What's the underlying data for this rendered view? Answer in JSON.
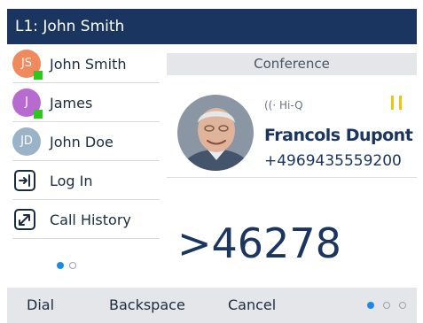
{
  "header": {
    "title": "L1: John Smith"
  },
  "sidebar": {
    "contacts": [
      {
        "initials": "JS",
        "name": "John Smith",
        "avatar_color": "#f08a5d",
        "presence": "available"
      },
      {
        "initials": "J",
        "name": "James",
        "avatar_color": "#b76bd1",
        "presence": "available"
      },
      {
        "initials": "JD",
        "name": "John Doe",
        "avatar_color": "#9bb3c7",
        "presence": "none"
      }
    ],
    "functions": [
      {
        "label": "Log In",
        "icon": "login-icon"
      },
      {
        "label": "Call History",
        "icon": "call-history-icon"
      }
    ],
    "pager": {
      "current": 1,
      "total": 2
    }
  },
  "main": {
    "header": "Conference",
    "call": {
      "audio_badge": "Hi-Q",
      "status_icon": "hold-icon",
      "name": "Francols Dupont",
      "number": "+4969435559200"
    },
    "dial_entry": ">46278"
  },
  "softkeys": {
    "keys": [
      "Dial",
      "Backspace",
      "Cancel"
    ],
    "pager": {
      "current": 1,
      "total": 3
    }
  },
  "colors": {
    "title_bar": "#1a3560",
    "text_primary": "#1a3560",
    "softkey_bar": "#e4e6ea",
    "presence_available": "#2cc81b",
    "hold": "#f1c40f",
    "pager_active": "#1e88e5"
  }
}
